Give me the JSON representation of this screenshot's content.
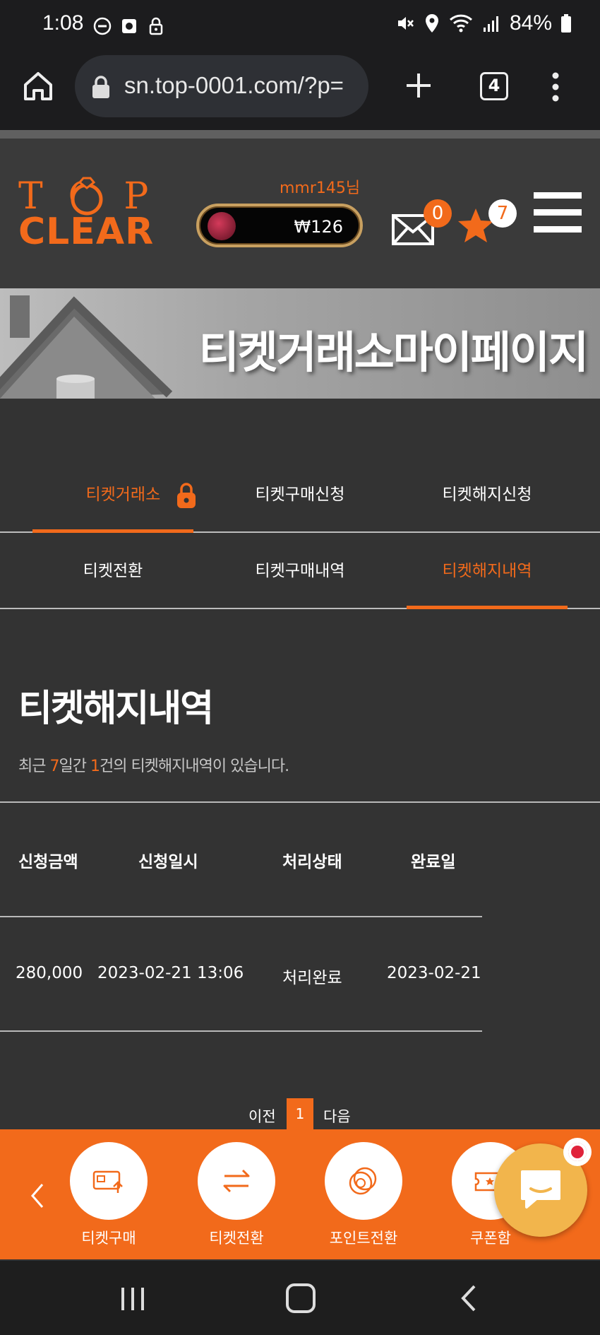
{
  "status_bar": {
    "time": "1:08",
    "battery": "84%"
  },
  "browser": {
    "url": "sn.top-0001.com/?p=",
    "tab_count": "4"
  },
  "header": {
    "logo_top": "TOP",
    "logo_bottom": "CLEAR",
    "username": "mmr145님",
    "balance": "₩126",
    "mail_count": "0",
    "star_count": "7"
  },
  "banner": {
    "title": "티켓거래소마이페이지"
  },
  "tabs": {
    "row1": [
      {
        "label": "티켓거래소",
        "active": true
      },
      {
        "label": "티켓구매신청",
        "active": false
      },
      {
        "label": "티켓해지신청",
        "active": false
      }
    ],
    "row2": [
      {
        "label": "티켓전환",
        "active": false
      },
      {
        "label": "티켓구매내역",
        "active": false
      },
      {
        "label": "티켓해지내역",
        "active": true
      }
    ]
  },
  "section": {
    "title": "티켓해지내역",
    "summary_prefix": "최근 ",
    "summary_days": "7",
    "summary_mid": "일간 ",
    "summary_count": "1",
    "summary_suffix": "건의 티켓해지내역이 있습니다."
  },
  "table": {
    "headers": [
      "신청금액",
      "신청일시",
      "처리상태",
      "완료일"
    ],
    "rows": [
      [
        "280,000",
        "2023-02-21 13:06",
        "처리완료",
        "2023-02-21"
      ]
    ]
  },
  "pagination": {
    "prev": "이전",
    "current": "1",
    "next": "다음"
  },
  "quickbar": {
    "items": [
      {
        "label": "티켓구매",
        "icon": "ticket-buy-icon"
      },
      {
        "label": "티켓전환",
        "icon": "exchange-icon"
      },
      {
        "label": "포인트전환",
        "icon": "coins-icon"
      },
      {
        "label": "쿠폰함",
        "icon": "coupon-icon"
      }
    ]
  },
  "colors": {
    "accent": "#f26a1b",
    "background": "#333333",
    "chat": "#f2b54c"
  }
}
